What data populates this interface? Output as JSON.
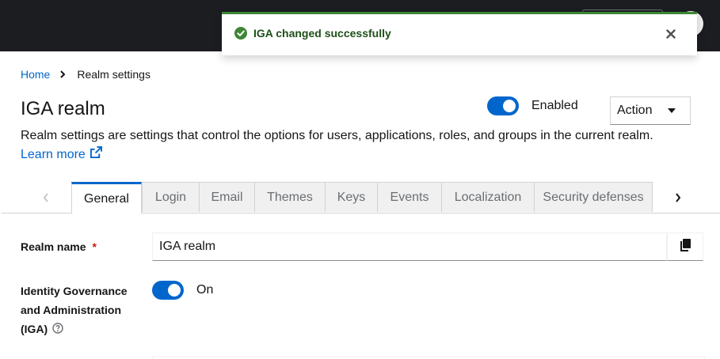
{
  "toast": {
    "title": "IGA changed successfully",
    "status_color": "#3e8635",
    "icon": "check-circle-icon",
    "close_icon": "times-icon"
  },
  "breadcrumb": {
    "home": "Home",
    "current": "Realm settings"
  },
  "header": {
    "title": "IGA realm",
    "enabled_label": "Enabled",
    "action_label": "Action",
    "description": "Realm settings are settings that control the options for users, applications, roles, and groups in the current realm.",
    "learn_more_1": "Learn",
    "learn_more_2": "more"
  },
  "tabs": [
    "General",
    "Login",
    "Email",
    "Themes",
    "Keys",
    "Events",
    "Localization",
    "Security defenses"
  ],
  "active_tab": "General",
  "form": {
    "realm_name_label": "Realm name",
    "required_marker": "*",
    "realm_name_value": "IGA realm",
    "iga_label_line1": "Identity Governance",
    "iga_label_line2": "and Administration",
    "iga_label_line3": "(IGA)",
    "iga_state": "On"
  },
  "colors": {
    "accent": "#0066cc",
    "masthead": "#1b1d21",
    "success": "#3e8635",
    "required": "#c9190b"
  }
}
